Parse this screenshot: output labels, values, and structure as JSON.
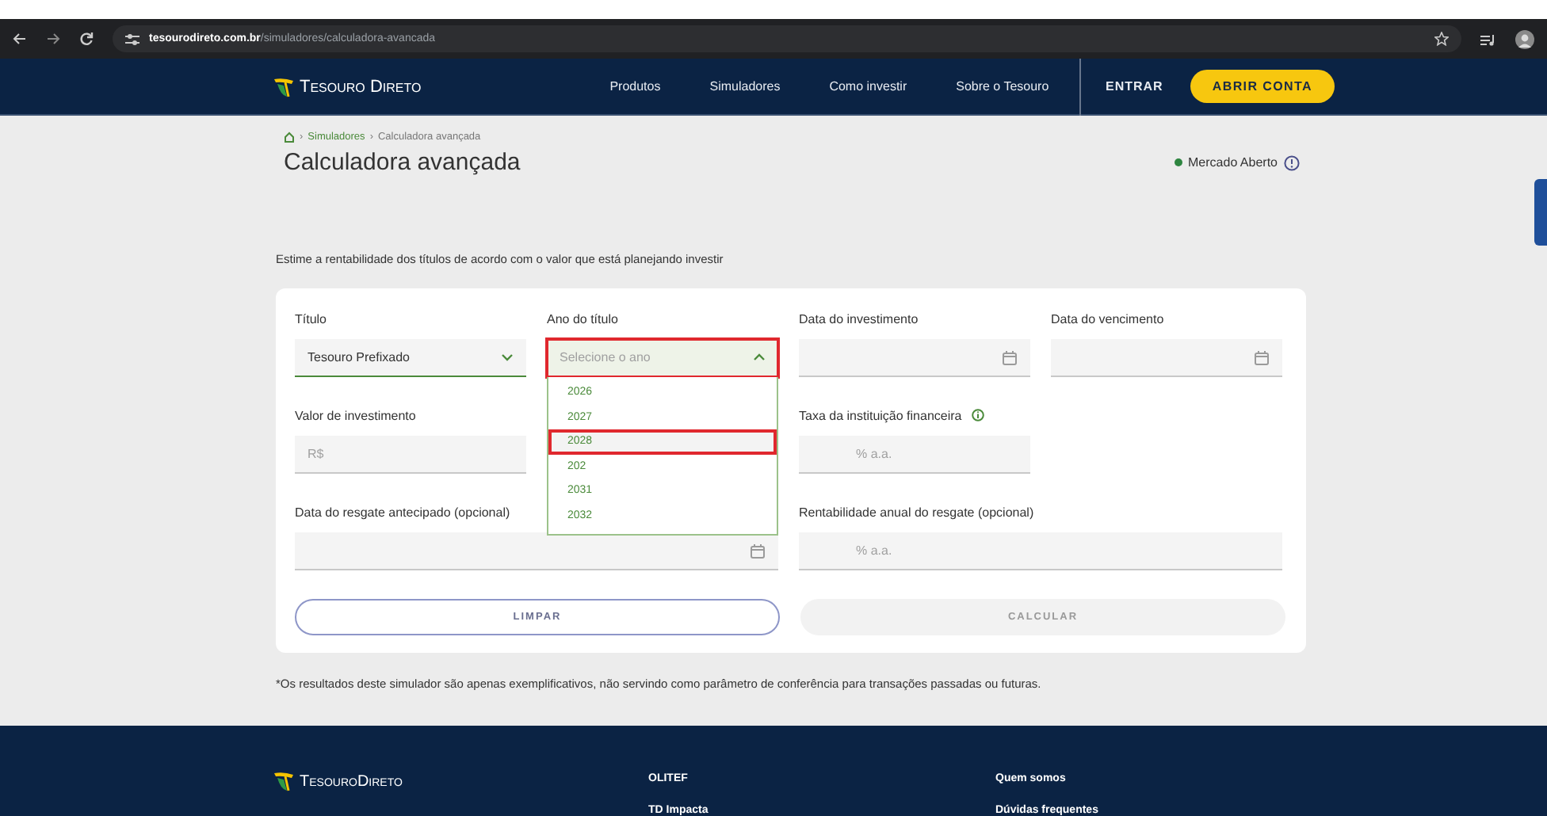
{
  "browser": {
    "url_host": "tesourodireto.com.br",
    "url_path": "/simuladores/calculadora-avancada"
  },
  "nav": {
    "logo": "Tesouro Direto",
    "links": [
      "Produtos",
      "Simuladores",
      "Como investir",
      "Sobre o Tesouro"
    ],
    "login": "ENTRAR",
    "cta": "ABRIR CONTA"
  },
  "breadcrumb": {
    "separator": "›",
    "items": [
      {
        "label": "Simuladores",
        "kind": "link"
      },
      {
        "label": "Calculadora avançada",
        "kind": "current"
      }
    ]
  },
  "title": "Calculadora avançada",
  "market_status": {
    "label": "Mercado Aberto",
    "color": "#2e8540"
  },
  "intro": "Estime a rentabilidade dos títulos de acordo com o valor que está planejando investir",
  "fields": [
    {
      "label": "Título",
      "kind": "select",
      "value": "Tesouro Prefixado",
      "open": false,
      "highlighted": false
    },
    {
      "label": "Ano do título",
      "kind": "select",
      "placeholder": "Selecione o ano",
      "open": true,
      "highlighted": true,
      "options": [
        {
          "label": "2026",
          "highlighted": false
        },
        {
          "label": "2027",
          "highlighted": false
        },
        {
          "label": "2028",
          "highlighted": true
        },
        {
          "label": "202",
          "highlighted": false
        },
        {
          "label": "2031",
          "highlighted": false
        },
        {
          "label": "2032",
          "highlighted": false
        }
      ]
    },
    {
      "label": "Data do investimento",
      "kind": "date"
    },
    {
      "label": "Data do vencimento",
      "kind": "date"
    },
    {
      "label": "Valor de investimento",
      "kind": "money",
      "placeholder": "R$"
    },
    {
      "label": "Taxa da instituição financeira",
      "kind": "percent",
      "placeholder": "% a.a.",
      "info": true
    },
    {
      "label": "Data do resgate antecipado (opcional)",
      "kind": "date"
    },
    {
      "label": "Rentabilidade anual do resgate (opcional)",
      "kind": "percent",
      "placeholder": "% a.a.",
      "info": false
    }
  ],
  "buttons": [
    {
      "label": "LIMPAR",
      "disabled": false
    },
    {
      "label": "CALCULAR",
      "disabled": true
    }
  ],
  "disclaimer": "*Os resultados deste simulador são apenas exemplificativos, não servindo como parâmetro de conferência para transações passadas ou futuras.",
  "footer": {
    "logo": "TesouroDireto",
    "columns": [
      [
        "OLITEF",
        "TD Impacta"
      ],
      [
        "Quem somos",
        "Dúvidas frequentes"
      ]
    ]
  }
}
